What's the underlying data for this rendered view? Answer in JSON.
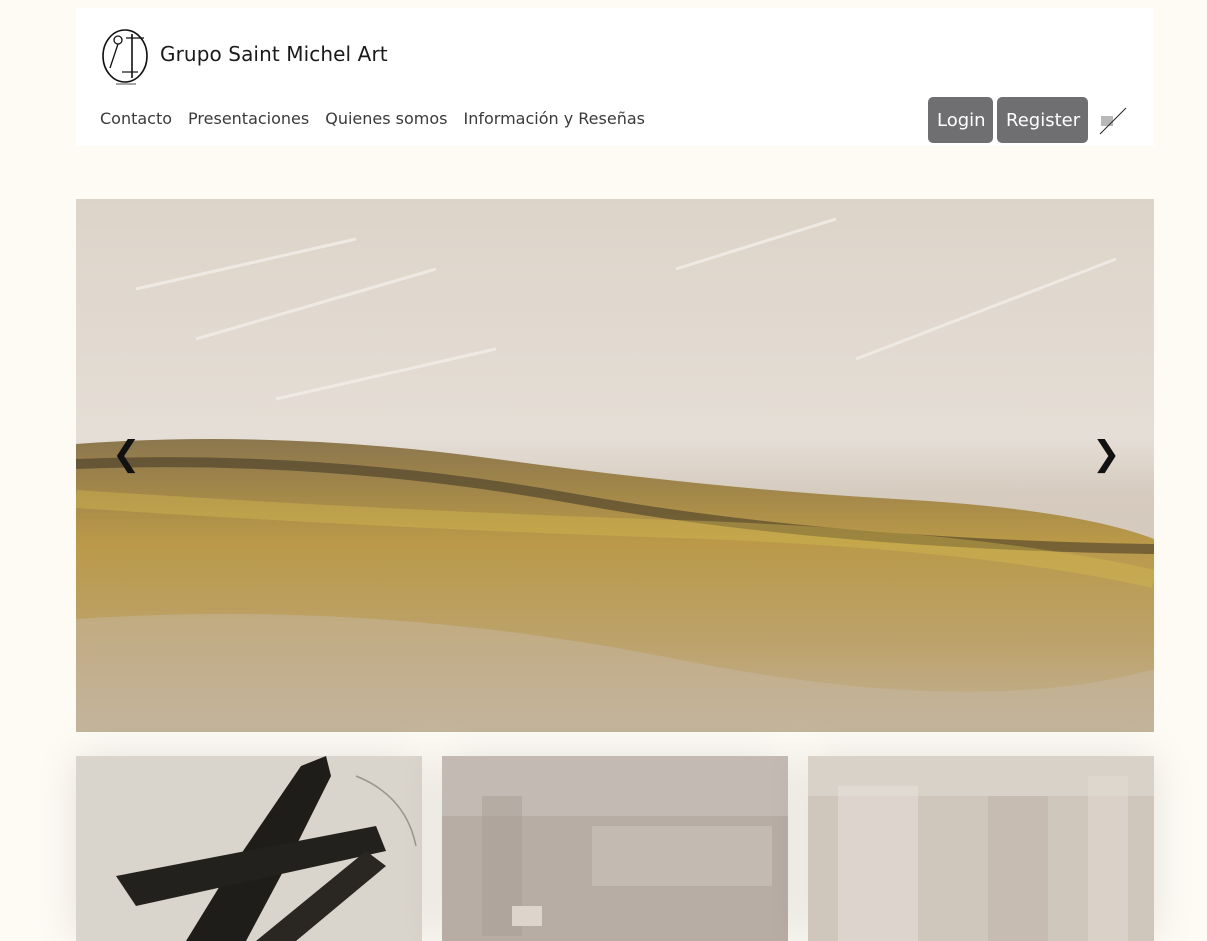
{
  "site": {
    "title": "Grupo Saint Michel Art"
  },
  "nav": {
    "items": [
      {
        "label": "Contacto"
      },
      {
        "label": "Presentaciones"
      },
      {
        "label": "Quienes somos"
      },
      {
        "label": "Información y Reseñas"
      }
    ]
  },
  "auth": {
    "login_label": "Login",
    "register_label": "Register"
  },
  "slider": {
    "prev_label": "❮",
    "next_label": "❯"
  },
  "logo": {
    "icon": "saint-michel-logo",
    "text": "ART"
  },
  "flag": {
    "icon": "language-flag-icon"
  },
  "colors": {
    "background": "#fdfbf4",
    "header": "#ffffff",
    "button": "#6f6f71"
  }
}
